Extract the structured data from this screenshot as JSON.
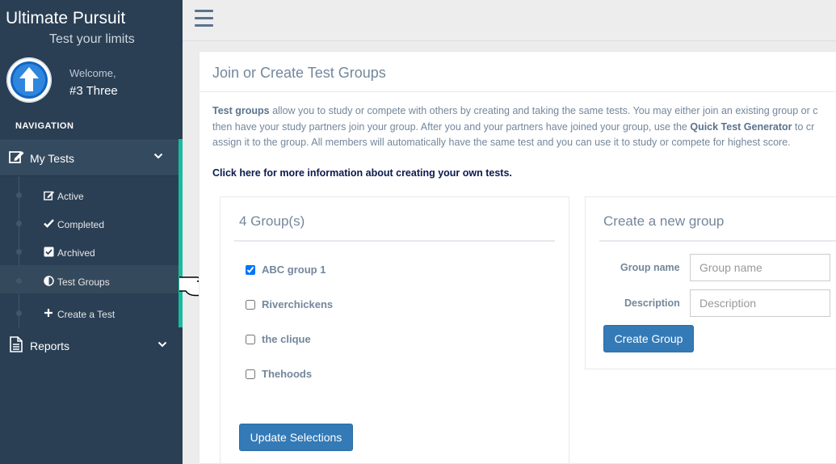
{
  "sidebar": {
    "brand_title": "Ultimate Pursuit",
    "brand_subtitle": "Test your limits",
    "welcome_label": "Welcome,",
    "username": "#3 Three",
    "nav_heading": "NAVIGATION",
    "my_tests": {
      "label": "My Tests",
      "items": [
        {
          "label": "Active",
          "icon": "edit-icon"
        },
        {
          "label": "Completed",
          "icon": "check-icon"
        },
        {
          "label": "Archived",
          "icon": "checkbox-icon"
        },
        {
          "label": "Test Groups",
          "icon": "half-circle-icon",
          "active": true
        },
        {
          "label": "Create a Test",
          "icon": "plus-icon"
        }
      ]
    },
    "reports": {
      "label": "Reports"
    }
  },
  "page": {
    "title": "Join or Create Test Groups",
    "intro_lines": [
      [
        "Test groups",
        " allow you to study or compete with others by creating and taking the same tests. You may either join an existing group or c"
      ],
      [
        "",
        "then have your study partners join your group. After you and your partners have joined your group, use the ",
        "Quick Test Generator",
        " to cr"
      ],
      [
        "",
        "assign it to the group. All members will automatically have the same test and you can use it to study or compete for highest score."
      ]
    ],
    "info_link": "Click here for more information about creating your own tests."
  },
  "groups": {
    "title": "4 Group(s)",
    "items": [
      {
        "name": "ABC group 1",
        "checked": true
      },
      {
        "name": "Riverchickens",
        "checked": false
      },
      {
        "name": "the clique",
        "checked": false
      },
      {
        "name": "Thehoods",
        "checked": false
      }
    ],
    "update_button": "Update Selections"
  },
  "create_group": {
    "title": "Create a new group",
    "name_label": "Group name",
    "name_placeholder": "Group name",
    "desc_label": "Description",
    "desc_placeholder": "Description",
    "create_button": "Create Group"
  },
  "colors": {
    "sidebar_bg": "#2a3f54",
    "accent_green": "#1abb9c",
    "primary_button": "#337ab7"
  }
}
